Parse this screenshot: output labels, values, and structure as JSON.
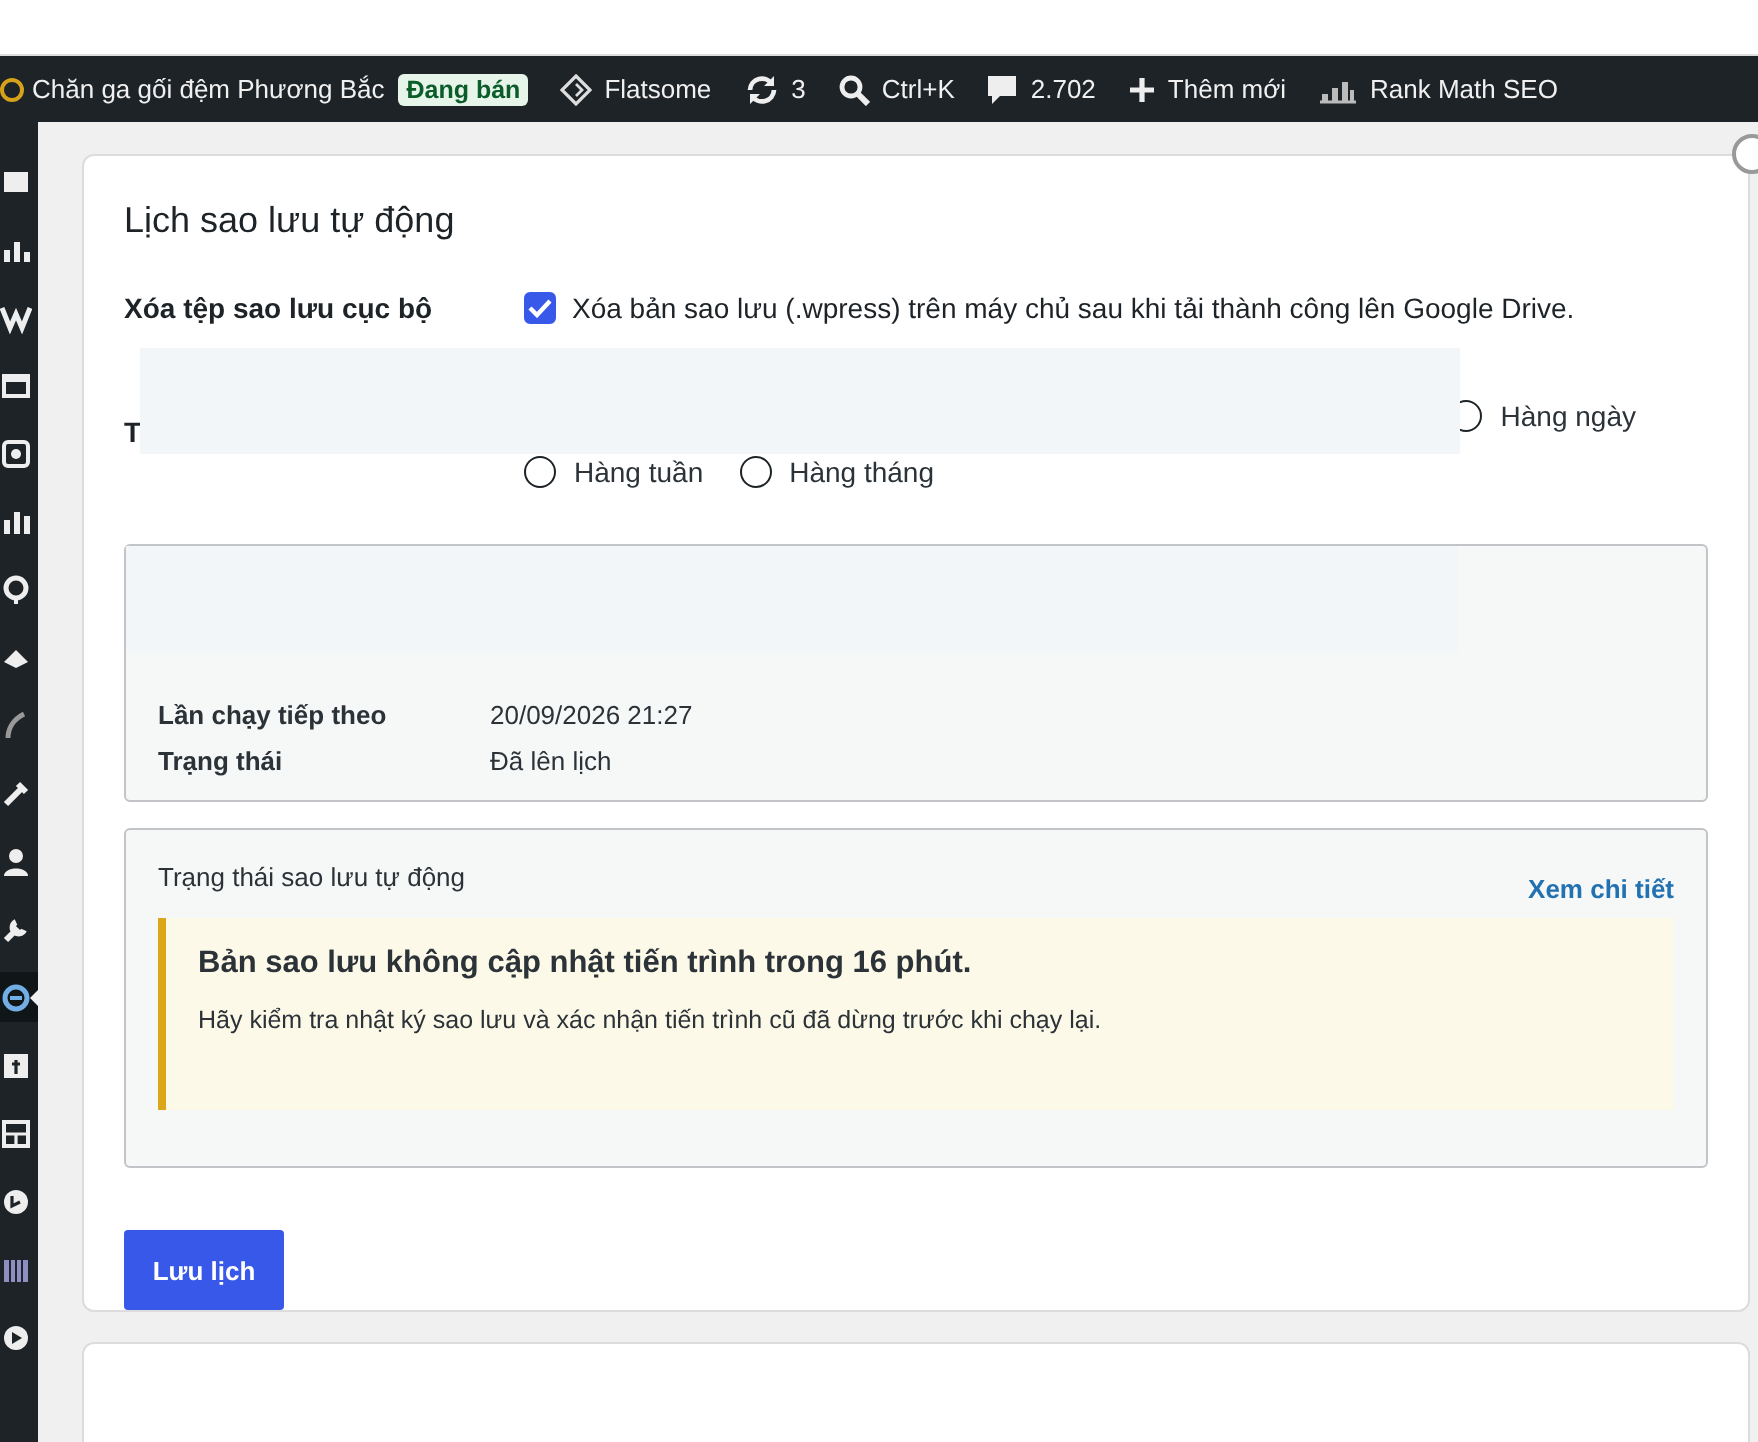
{
  "admin_bar": {
    "site_name": "Chăn ga gối đệm Phương Bắc",
    "site_badge": "Đang bán",
    "theme": "Flatsome",
    "updates": "3",
    "search_shortcut": "Ctrl+K",
    "comments": "2.702",
    "new_label": "Thêm mới",
    "seo_label": "Rank Math SEO"
  },
  "sidebar": {
    "items": [
      {
        "selected": false
      },
      {
        "selected": false
      },
      {
        "selected": false
      },
      {
        "selected": false
      },
      {
        "selected": false
      },
      {
        "selected": false
      },
      {
        "selected": false
      },
      {
        "selected": false
      },
      {
        "selected": false
      },
      {
        "selected": false
      },
      {
        "selected": false
      },
      {
        "selected": false
      },
      {
        "selected": true
      },
      {
        "selected": false
      },
      {
        "selected": false
      },
      {
        "selected": false
      },
      {
        "selected": false
      },
      {
        "selected": false
      }
    ]
  },
  "schedule_card": {
    "title": "Lịch sao lưu tự động",
    "delete_local": {
      "label": "Xóa tệp sao lưu cục bộ",
      "checked": true,
      "text": "Xóa bản sao lưu (.wpress) trên máy chủ sau khi tải thành công lên Google Drive."
    },
    "frequency": {
      "label": "T",
      "options": [
        {
          "label": "Hàng ngày",
          "selected": false
        },
        {
          "label": "Hàng tuần",
          "selected": false
        },
        {
          "label": "Hàng tháng",
          "selected": false
        }
      ]
    },
    "summary": [
      {
        "label": "Lần chạy tiếp theo",
        "value": "20/09/2026 21:27"
      },
      {
        "label": "Trạng thái",
        "value": "Đã lên lịch"
      }
    ],
    "status_box": {
      "title": "Trạng thái sao lưu tự động",
      "link": "Xem chi tiết",
      "notice": {
        "title": "Bản sao lưu không cập nhật tiến trình trong 16 phút.",
        "text": "Hãy kiểm tra nhật ký sao lưu và xác nhận tiến trình cũ đã dừng trước khi chạy lại."
      }
    },
    "save_button": "Lưu lịch"
  }
}
